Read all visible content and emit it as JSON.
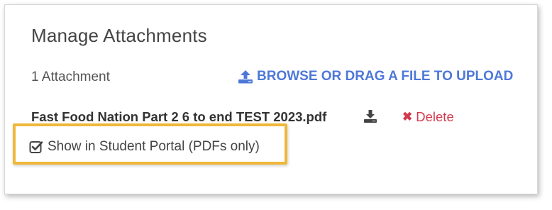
{
  "attachments": {
    "title": "Manage Attachments",
    "count_text": "1 Attachment",
    "upload_label": "BROWSE OR DRAG A FILE TO UPLOAD",
    "upload_icon": "upload-icon",
    "files": [
      {
        "name": "Fast Food Nation Part 2 6 to end TEST 2023.pdf",
        "download_icon": "download-icon",
        "delete_label": "Delete",
        "delete_icon": "close-icon"
      }
    ],
    "student_portal": {
      "label": "Show in Student Portal (PDFs only)",
      "checked": true
    }
  },
  "colors": {
    "link_blue": "#4e78d8",
    "delete_red": "#d23a4e",
    "highlight": "#f0b83a"
  }
}
